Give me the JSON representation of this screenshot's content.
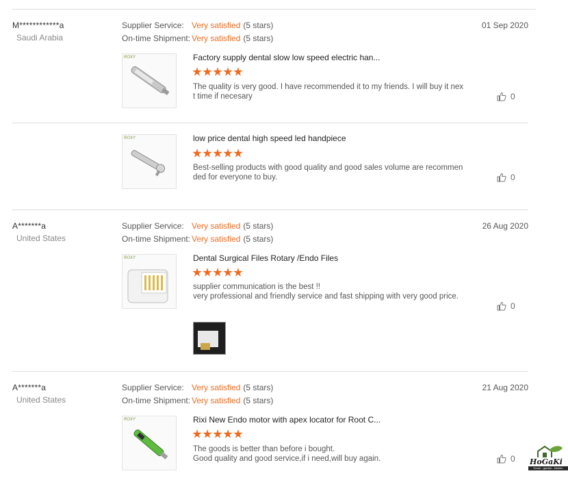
{
  "labels": {
    "supplier_service": "Supplier Service:",
    "ontime_shipment": "On-time Shipment:"
  },
  "reviews": [
    {
      "buyer": "M************a",
      "country": "Saudi Arabia",
      "date": "01 Sep 2020",
      "supplier_rating": "Very satisfied",
      "supplier_count": "(5 stars)",
      "shipment_rating": "Very satisfied",
      "shipment_count": "(5 stars)",
      "items": [
        {
          "title": "Factory supply dental slow low speed electric han...",
          "stars": 5,
          "comment": [
            "The quality is very good. I have recommended it to my friends. I will buy it next time if necesary"
          ],
          "likes": "0",
          "thumb_icon": "dental-slow-speed-handpiece"
        },
        {
          "title": "low price dental high speed led handpiece",
          "stars": 5,
          "comment": [
            "Best-selling products with good quality and good sales volume are recommended for everyone to buy."
          ],
          "likes": "0",
          "thumb_icon": "dental-high-speed-handpiece"
        }
      ]
    },
    {
      "buyer": "A*******a",
      "country": "United States",
      "date": "26 Aug 2020",
      "supplier_rating": "Very satisfied",
      "supplier_count": "(5 stars)",
      "shipment_rating": "Very satisfied",
      "shipment_count": "(5 stars)",
      "items": [
        {
          "title": "Dental Surgical Files Rotary /Endo Files",
          "stars": 5,
          "comment": [
            "supplier communication is the best !!",
            "very professional and friendly service and fast shipping with very good price."
          ],
          "likes": "0",
          "thumb_icon": "endo-files-box"
        }
      ]
    },
    {
      "buyer": "A*******a",
      "country": "United States",
      "date": "21 Aug 2020",
      "supplier_rating": "Very satisfied",
      "supplier_count": "(5 stars)",
      "shipment_rating": "Very satisfied",
      "shipment_count": "(5 stars)",
      "items": [
        {
          "title": "Rixi New Endo motor with apex locator for Root C...",
          "stars": 5,
          "comment": [
            "The goods is better than before i bought.",
            "Good quality and good service,if i need,will buy again."
          ],
          "likes": "0",
          "thumb_icon": "endo-motor"
        }
      ]
    }
  ],
  "watermark": {
    "brand": "HoGaKi",
    "tagline": "Home - garden - kitchen"
  },
  "colors": {
    "accent": "#f06a1e",
    "divider": "#dcdcdc"
  }
}
